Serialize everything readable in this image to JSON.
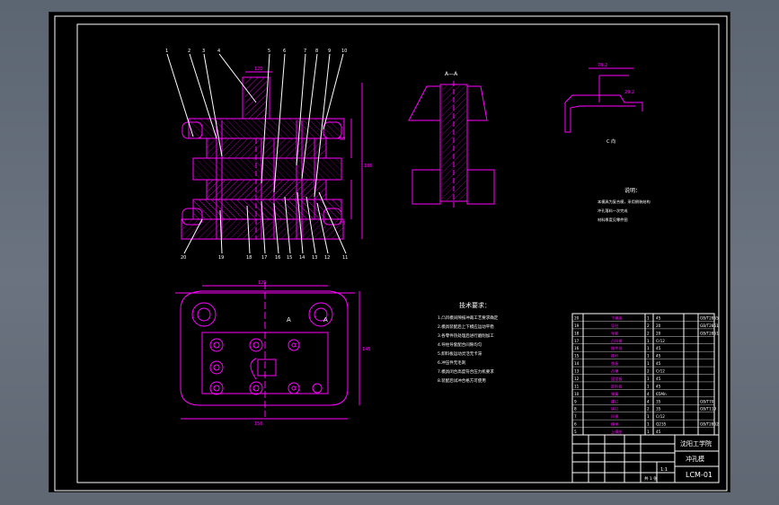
{
  "drawing": {
    "section_label": "A—A",
    "view_c_label": "C 向",
    "view_a_left": "A",
    "view_a_right": "A",
    "notes_title": "说明：",
    "tech_title": "技术要求：",
    "tech_lines": [
      "1.凸凹模间隙按冲裁工艺要求确定",
      "2.模具装配后上下模应运动平稳",
      "3.各零件热处理后进行磨削加工",
      "4.导柱导套配合间隙均匀",
      "5.卸料板运动灵活无卡滞",
      "6.冲压件无毛刺",
      "7.模具闭合高度符合压力机要求",
      "8.装配后试冲合格方可使用"
    ],
    "notes_lines": [
      "本模具为复合模，采用倒装结构",
      "冲孔落料一次完成",
      "材料厚度见零件图"
    ],
    "dims": {
      "top_width": "120",
      "height_total": "186",
      "plan_width": "156",
      "plan_inner": "120",
      "plan_height": "145",
      "dim_a": "50",
      "dim_b": "76",
      "part_w": "78.2",
      "part_h": "29.2"
    },
    "balloons_top": [
      "1",
      "2",
      "3",
      "4",
      "5",
      "6",
      "7",
      "8",
      "9",
      "10"
    ],
    "balloons_bottom": [
      "20",
      "19",
      "18",
      "17",
      "16",
      "15",
      "14",
      "13",
      "12",
      "11"
    ]
  },
  "title_block": {
    "school": "沈阳工学院",
    "drawing_name": "冲孔模",
    "drawing_no": "LCM-01",
    "scale": "1:1",
    "sheet": "共 1 张"
  },
  "bom": {
    "rows": [
      [
        "20",
        "下模座",
        "1",
        "45",
        "GB/T2855"
      ],
      [
        "19",
        "导柱",
        "2",
        "20",
        "GB/T2861"
      ],
      [
        "18",
        "导套",
        "2",
        "20",
        "GB/T2861"
      ],
      [
        "17",
        "凸凹模",
        "1",
        "Cr12",
        ""
      ],
      [
        "16",
        "推件块",
        "1",
        "45",
        ""
      ],
      [
        "15",
        "推杆",
        "1",
        "45",
        ""
      ],
      [
        "14",
        "垫板",
        "1",
        "45",
        ""
      ],
      [
        "13",
        "凸模",
        "2",
        "Cr12",
        ""
      ],
      [
        "12",
        "固定板",
        "1",
        "45",
        ""
      ],
      [
        "11",
        "卸料板",
        "1",
        "45",
        ""
      ],
      [
        "10",
        "弹簧",
        "4",
        "65Mn",
        ""
      ],
      [
        "9",
        "螺钉",
        "4",
        "35",
        "GB/T70"
      ],
      [
        "8",
        "销钉",
        "2",
        "35",
        "GB/T119"
      ],
      [
        "7",
        "凹模",
        "1",
        "Cr12",
        ""
      ],
      [
        "6",
        "模柄",
        "1",
        "Q235",
        "GB/T2862"
      ],
      [
        "5",
        "上模座",
        "1",
        "45",
        ""
      ]
    ]
  },
  "colors": {
    "background": "#5f6773",
    "sheet": "#000000",
    "line": "#ff00ff",
    "text": "#ffffff"
  }
}
